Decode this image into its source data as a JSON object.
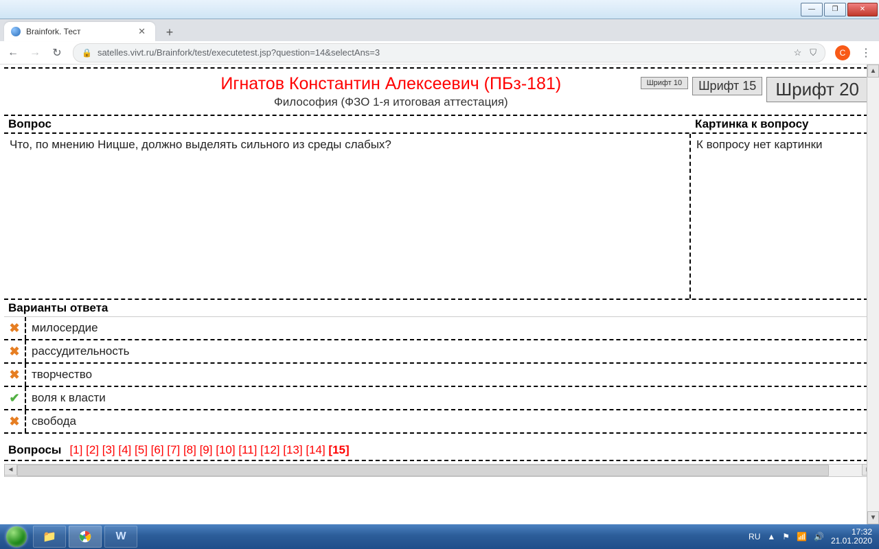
{
  "window": {
    "minimize": "—",
    "maximize": "❐",
    "close": "✕"
  },
  "browser": {
    "tab_title": "Brainfork. Тест",
    "tab_close": "✕",
    "newtab": "+",
    "url": "satelles.vivt.ru/Brainfork/test/executetest.jsp?question=14&selectAns=3",
    "back": "←",
    "forward": "→",
    "reload": "↻",
    "lock": "🔒",
    "star": "☆",
    "shield": "⛉",
    "profile": "C",
    "menu": "⋮"
  },
  "header": {
    "student": "Игнатов Константин Алексеевич (ПБз-181)",
    "course": "Философия (ФЗО 1-я итоговая аттестация)",
    "font10": "Шрифт 10",
    "font15": "Шрифт 15",
    "font20": "Шрифт 20"
  },
  "question": {
    "label": "Вопрос",
    "image_label": "Картинка к вопросу",
    "text": "Что, по мнению Ницше, должно выделять сильного из среды слабых?",
    "image_text": "К вопросу нет картинки",
    "answers_label": "Варианты ответа",
    "answers": [
      {
        "text": "милосердие",
        "correct": false
      },
      {
        "text": "рассудительность",
        "correct": false
      },
      {
        "text": "творчество",
        "correct": false
      },
      {
        "text": "воля к власти",
        "correct": true
      },
      {
        "text": "свобода",
        "correct": false
      }
    ]
  },
  "nav": {
    "label": "Вопросы",
    "items": [
      "[1]",
      "[2]",
      "[3]",
      "[4]",
      "[5]",
      "[6]",
      "[7]",
      "[8]",
      "[9]",
      "[10]",
      "[11]",
      "[12]",
      "[13]",
      "[14]"
    ],
    "current": "[15]"
  },
  "taskbar": {
    "lang": "RU",
    "time": "17:32",
    "date": "21.01.2020",
    "tray_up": "▲",
    "tray_flag": "⚑",
    "tray_net": "📶",
    "tray_vol": "🔊"
  }
}
